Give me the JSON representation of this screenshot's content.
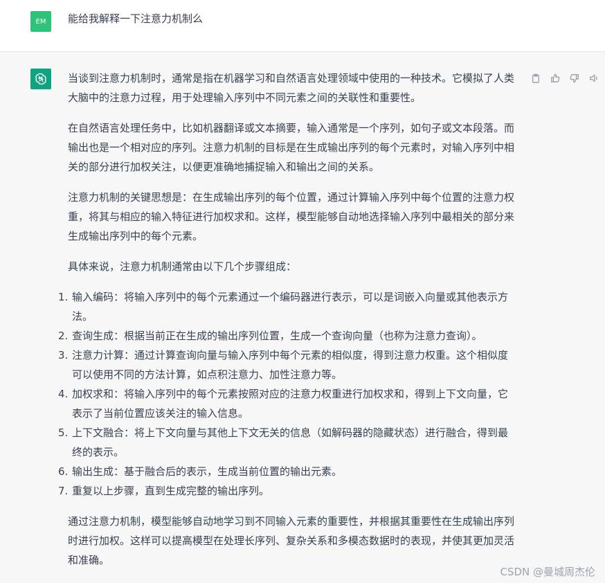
{
  "user": {
    "avatar_initials": "EM",
    "message": "能给我解释一下注意力机制么"
  },
  "assistant": {
    "paragraphs": [
      "当谈到注意力机制时，通常是指在机器学习和自然语言处理领域中使用的一种技术。它模拟了人类大脑中的注意力过程，用于处理输入序列中不同元素之间的关联性和重要性。",
      "在自然语言处理任务中，比如机器翻译或文本摘要，输入通常是一个序列，如句子或文本段落。而输出也是一个相对应的序列。注意力机制的目标是在生成输出序列的每个元素时，对输入序列中相关的部分进行加权关注，以便更准确地捕捉输入和输出之间的关系。",
      "注意力机制的关键思想是：在生成输出序列的每个位置，通过计算输入序列中每个位置的注意力权重，将其与相应的输入特征进行加权求和。这样，模型能够自动地选择输入序列中最相关的部分来生成输出序列中的每个元素。",
      "具体来说，注意力机制通常由以下几个步骤组成："
    ],
    "steps": [
      {
        "num": "1.",
        "text": "输入编码：将输入序列中的每个元素通过一个编码器进行表示，可以是词嵌入向量或其他表示方法。"
      },
      {
        "num": "2.",
        "text": "查询生成：根据当前正在生成的输出序列位置，生成一个查询向量（也称为注意力查询）。"
      },
      {
        "num": "3.",
        "text": "注意力计算：通过计算查询向量与输入序列中每个元素的相似度，得到注意力权重。这个相似度可以使用不同的方法计算，如点积注意力、加性注意力等。"
      },
      {
        "num": "4.",
        "text": "加权求和：将输入序列中的每个元素按照对应的注意力权重进行加权求和，得到上下文向量，它表示了当前位置应该关注的输入信息。"
      },
      {
        "num": "5.",
        "text": "上下文融合：将上下文向量与其他上下文无关的信息（如解码器的隐藏状态）进行融合，得到最终的表示。"
      },
      {
        "num": "6.",
        "text": "输出生成：基于融合后的表示，生成当前位置的输出元素。"
      },
      {
        "num": "7.",
        "text": "重复以上步骤，直到生成完整的输出序列。"
      }
    ],
    "conclusion": "通过注意力机制，模型能够自动地学习到不同输入元素的重要性，并根据其重要性在生成输出序列时进行加权。这样可以提高模型在处理长序列、复杂关系和多模态数据时的表现，并使其更加灵活和准确。"
  },
  "actions": [
    "clipboard-icon",
    "thumbs-up-icon",
    "thumbs-down-icon",
    "speaker-icon"
  ],
  "watermark": "CSDN @曼城周杰伦",
  "colors": {
    "user_avatar": "#2fc37a",
    "bot_avatar": "#10a37f",
    "bot_bg": "#f7f7f8"
  }
}
